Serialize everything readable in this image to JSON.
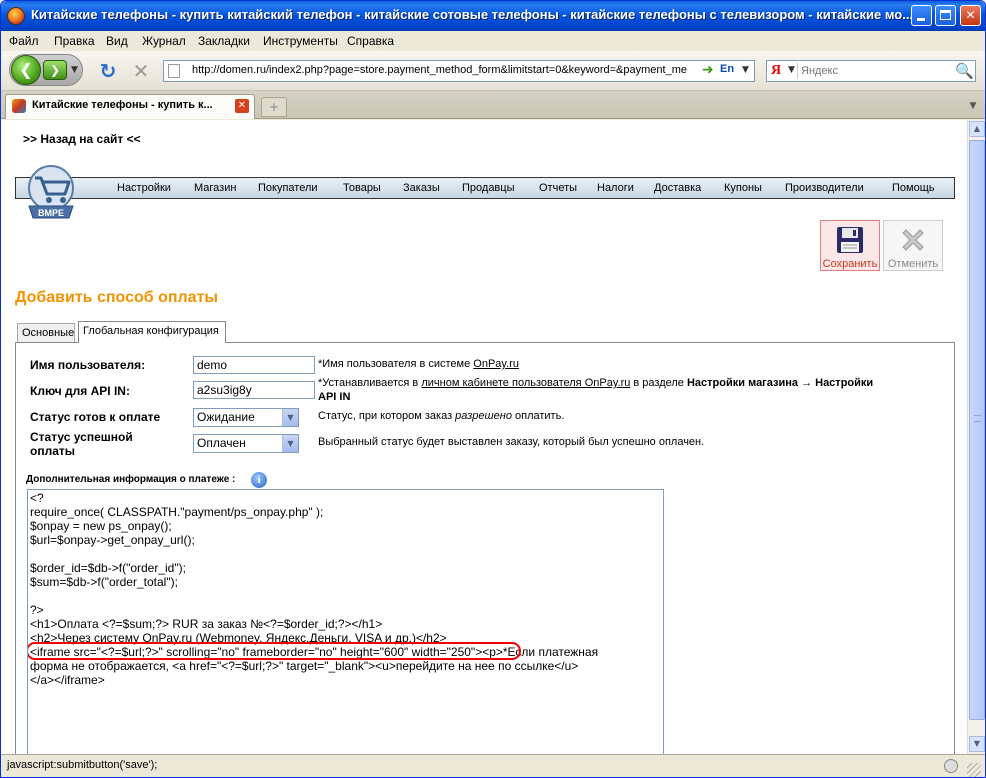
{
  "window": {
    "title": "Китайские телефоны - купить китайский телефон - китайские сотовые телефоны - китайские телефоны с телевизором - китайские мо..."
  },
  "menu": [
    "Файл",
    "Правка",
    "Вид",
    "Журнал",
    "Закладки",
    "Инструменты",
    "Справка"
  ],
  "navbar": {
    "url": "http://domen.ru/index2.php?page=store.payment_method_form&limitstart=0&keyword=&payment_me",
    "lang_label": "En",
    "search_engine": "Я",
    "search_placeholder": "Яндекс"
  },
  "tabs": {
    "active_label": "Китайские телефоны - купить к...",
    "new_tab_label": "+"
  },
  "page": {
    "back_link": ">> Назад на сайт <<",
    "logo_text": "BMPE",
    "nav": [
      "Настройки",
      "Магазин",
      "Покупатели",
      "Товары",
      "Заказы",
      "Продавцы",
      "Отчеты",
      "Налоги",
      "Доставка",
      "Купоны",
      "Производители",
      "Помощь"
    ],
    "save_label": "Сохранить",
    "cancel_label": "Отменить",
    "title": "Добавить способ оплаты",
    "form_tabs": [
      "Основные",
      "Глобальная конфигурация"
    ],
    "fields": {
      "username_label": "Имя пользователя:",
      "username_value": "demo",
      "username_help_prefix": "*Имя пользователя в системе ",
      "username_help_link": "OnPay.ru",
      "apikey_label": "Ключ для API IN:",
      "apikey_value": "a2su3ig8y",
      "apikey_help_prefix": "*Устанавливается в ",
      "apikey_help_link": "личном кабинете пользователя OnPay.ru",
      "apikey_help_mid": " в разделе ",
      "apikey_help_bold_1": "Настройки магазина → Настройки",
      "apikey_help_bold_2": "API IN",
      "status_ready_label": "Статус готов к оплате",
      "status_ready_value": "Ожидание",
      "status_ready_help_prefix": "Статус, при котором заказ ",
      "status_ready_help_em": "разрешено",
      "status_ready_help_suffix": " оплатить.",
      "status_success_label_1": "Статус успешной",
      "status_success_label_2": "оплаты",
      "status_success_value": "Оплачен",
      "status_success_help": "Выбранный статус будет выставлен заказу, который был успешно оплачен."
    },
    "extra_info_label": "Дополнительная информация о платеже :",
    "code_lines": [
      "<?",
      "require_once( CLASSPATH.\"payment/ps_onpay.php\" );",
      "$onpay = new ps_onpay();",
      "$url=$onpay->get_onpay_url();",
      "",
      "$order_id=$db->f(\"order_id\");",
      "$sum=$db->f(\"order_total\");",
      "",
      "?>",
      "<h1>Оплата <?=$sum;?> RUR за заказ №<?=$order_id;?></h1>",
      "<h2>Через систему OnPay.ru (Webmoney, Яндекс.Деньги, VISA и др.)</h2>",
      "<iframe src=\"<?=$url;?>\" scrolling=\"no\" frameborder=\"no\" height=\"600\" width=\"250\"><p>*Если платежная",
      "форма не отображается, <a href=\"<?=$url;?>\" target=\"_blank\"><u>перейдите на нее по ссылке</u>",
      "</a></iframe>"
    ]
  },
  "status": {
    "text": "javascript:submitbutton('save');"
  },
  "colors": {
    "title_orange": "#f29400",
    "highlight_red": "#e00000",
    "xp_blue": "#0557e0"
  }
}
